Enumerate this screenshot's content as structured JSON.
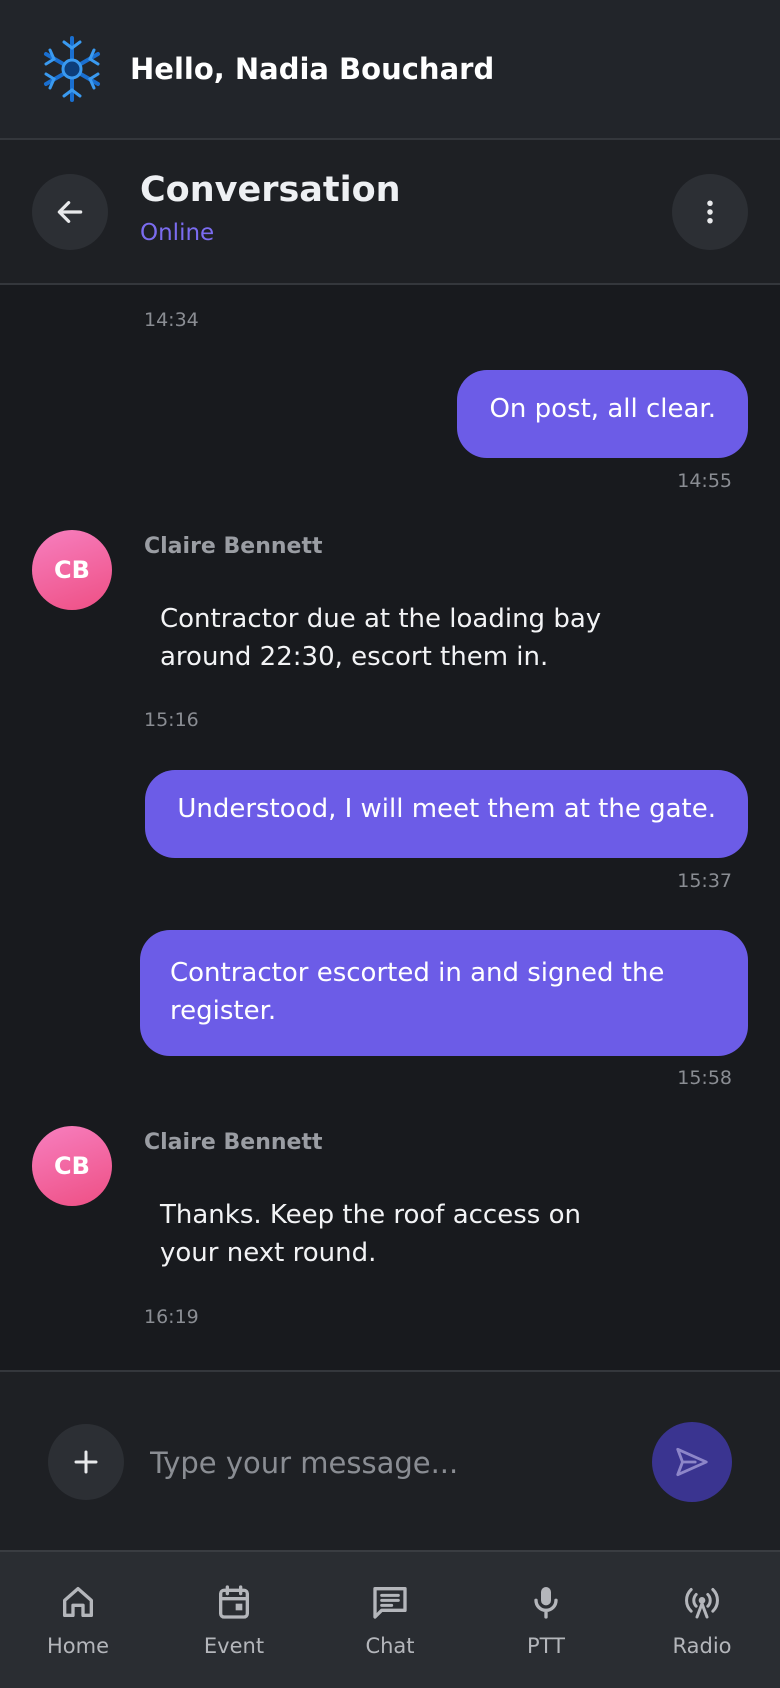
{
  "header": {
    "greeting": "Hello, Nadia Bouchard",
    "logo_icon": "snowflake-logo-icon"
  },
  "conversation": {
    "title": "Conversation",
    "status": "Online",
    "back_icon": "arrow-left-icon",
    "more_icon": "more-vertical-icon"
  },
  "messages": [
    {
      "direction": "in",
      "time": "14:34"
    },
    {
      "direction": "out",
      "text": "On post, all clear.",
      "time": "14:55"
    },
    {
      "direction": "in",
      "sender": "Claire Bennett",
      "initials": "CB",
      "text": "Contractor due at the loading bay around 22:30, escort them in.",
      "time": "15:16"
    },
    {
      "direction": "out",
      "text": "Understood, I will meet them at the gate.",
      "time": "15:37"
    },
    {
      "direction": "out",
      "text": "Contractor escorted in and signed the register.",
      "time": "15:58"
    },
    {
      "direction": "in",
      "sender": "Claire Bennett",
      "initials": "CB",
      "text": "Thanks. Keep the roof access on your next round.",
      "time": "16:19"
    }
  ],
  "composer": {
    "placeholder": "Type your message...",
    "add_icon": "plus-icon",
    "send_icon": "send-icon"
  },
  "nav": [
    {
      "label": "Home",
      "icon": "home-icon"
    },
    {
      "label": "Event",
      "icon": "calendar-icon"
    },
    {
      "label": "Chat",
      "icon": "chat-icon"
    },
    {
      "label": "PTT",
      "icon": "microphone-icon"
    },
    {
      "label": "Radio",
      "icon": "radio-tower-icon"
    }
  ],
  "colors": {
    "accent": "#6c5ce7",
    "status": "#7b6cf0",
    "avatar": "#ee4f84",
    "background": "#181a1e"
  }
}
